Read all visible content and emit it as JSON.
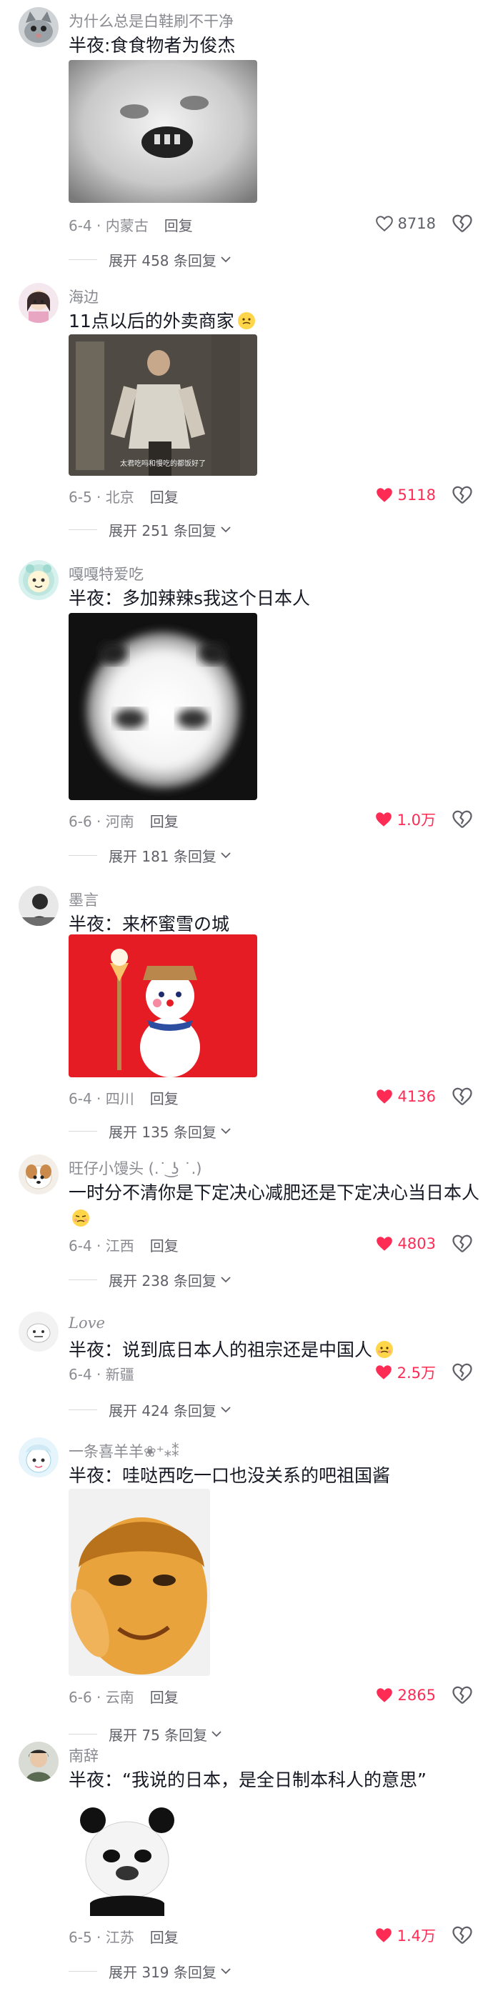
{
  "comments": [
    {
      "username": "为什么总是白鞋刷不干净",
      "text": "半夜:食食物者为俊杰",
      "date": "6-4",
      "location": "内蒙古",
      "reply": "回复",
      "likes": "8718",
      "liked": false,
      "expand": "展开 458 条回复",
      "emoji": false
    },
    {
      "username": "海边",
      "text": "11点以后的外卖商家",
      "date": "6-5",
      "location": "北京",
      "reply": "回复",
      "likes": "5118",
      "liked": true,
      "expand": "展开 251 条回复",
      "emoji": true,
      "image_caption": "太君吃吗和慢吃的都饭好了"
    },
    {
      "username": "嘎嘎特爱吃",
      "text": "半夜：多加辣辣s我这个日本人",
      "date": "6-6",
      "location": "河南",
      "reply": "回复",
      "likes": "1.0万",
      "liked": true,
      "expand": "展开 181 条回复",
      "emoji": false
    },
    {
      "username": "墨言",
      "text": "半夜：来杯蜜雪の城",
      "date": "6-4",
      "location": "四川",
      "reply": "回复",
      "likes": "4136",
      "liked": true,
      "expand": "展开 135 条回复",
      "emoji": false
    },
    {
      "username": "旺仔小馒头 (.˙ ͜ʖ ˙.)",
      "text": "一时分不清你是下定决心减肥还是下定决心当日本人",
      "date": "6-4",
      "location": "江西",
      "reply": "回复",
      "likes": "4803",
      "liked": true,
      "expand": "展开 238 条回复",
      "emoji": true
    },
    {
      "username": "Love",
      "text": "半夜：说到底日本人的祖宗还是中国人",
      "date": "6-4",
      "location": "新疆",
      "reply": "回复",
      "likes": "2.5万",
      "liked": true,
      "expand": "展开 424 条回复",
      "emoji": true
    },
    {
      "username": "一条喜羊羊❀⁺⁎⁑",
      "text": "半夜：哇哒西吃一口也没关系的吧祖国酱",
      "date": "6-6",
      "location": "云南",
      "reply": "回复",
      "likes": "2865",
      "liked": true,
      "expand": "展开 75 条回复",
      "emoji": false
    },
    {
      "username": "南辞",
      "text": "半夜：“我说的日本，是全日制本科人的意思”",
      "date": "6-5",
      "location": "江苏",
      "reply": "回复",
      "likes": "1.4万",
      "liked": true,
      "expand": "展开 319 条回复",
      "emoji": false
    }
  ],
  "colors": {
    "liked": "#fe2c55",
    "muted": "#8a8b91",
    "text": "#161823"
  },
  "icons": {
    "like": "heart-icon",
    "dislike": "broken-heart-icon",
    "expand": "chevron-down-icon"
  }
}
